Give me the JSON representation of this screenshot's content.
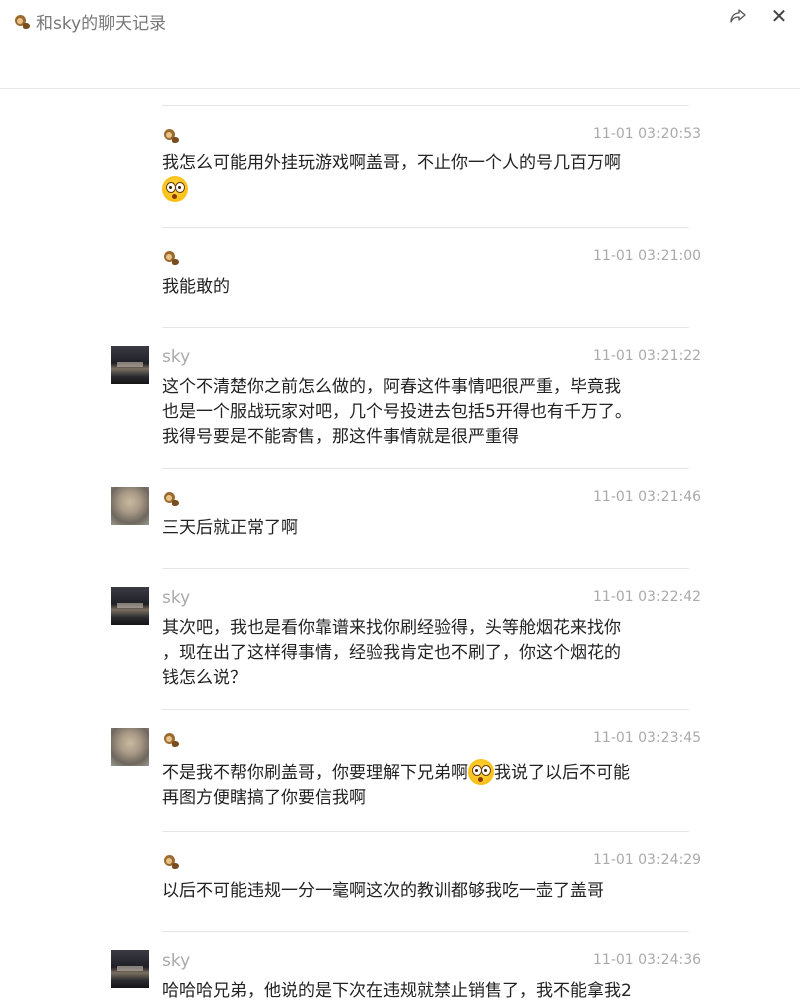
{
  "window": {
    "title": "和sky的聊天记录",
    "title_icon": "monkey-icon",
    "actions": [
      {
        "name": "share",
        "icon": "share-icon"
      },
      {
        "name": "close",
        "glyph": "✕"
      }
    ]
  },
  "messages": [
    {
      "sender": "",
      "avatar": "none",
      "sender_icon": "monkey-icon",
      "time": "11-01 03:20:53",
      "text_parts": [
        "我怎么可能用外挂玩游戏啊盖哥，不止你一个人的号几百万啊"
      ],
      "trailing_emoji": "flushed-emoji"
    },
    {
      "sender": "",
      "avatar": "none",
      "sender_icon": "monkey-icon",
      "time": "11-01 03:21:00",
      "text_parts": [
        "我能敢的"
      ]
    },
    {
      "sender": "sky",
      "avatar": "dark-landscape",
      "time": "11-01 03:21:22",
      "text_lines": [
        "这个不清楚你之前怎么做的，阿春这件事情吧很严重，毕竟我",
        "也是一个服战玩家对吧，几个号投进去包括5开得也有千万了。",
        "我得号要是不能寄售，那这件事情就是很严重得"
      ]
    },
    {
      "sender": "",
      "avatar": "face",
      "sender_icon": "monkey-icon",
      "time": "11-01 03:21:46",
      "text_parts": [
        "三天后就正常了啊"
      ]
    },
    {
      "sender": "sky",
      "avatar": "dark-landscape",
      "time": "11-01 03:22:42",
      "text_lines": [
        "其次吧，我也是看你靠谱来找你刷经验得，头等舱烟花来找你",
        "，现在出了这样得事情，经验我肯定也不刷了，你这个烟花的",
        "钱怎么说？"
      ]
    },
    {
      "sender": "",
      "avatar": "face",
      "sender_icon": "monkey-icon",
      "time": "11-01 03:23:45",
      "text_parts": [
        "不是我不帮你刷盖哥，你要理解下兄弟啊",
        "我说了以后不可能"
      ],
      "inline_emoji": "flushed-emoji",
      "line2": "再图方便瞎搞了你要信我啊"
    },
    {
      "sender": "",
      "avatar": "none",
      "sender_icon": "monkey-icon",
      "time": "11-01 03:24:29",
      "text_parts": [
        "以后不可能违规一分一毫啊这次的教训都够我吃一壶了盖哥"
      ]
    },
    {
      "sender": "sky",
      "avatar": "dark-landscape",
      "time": "11-01 03:24:36",
      "text_lines": [
        "哈哈哈兄弟，他说的是下次在违规就禁止销售了，我不能拿我2"
      ]
    }
  ]
}
